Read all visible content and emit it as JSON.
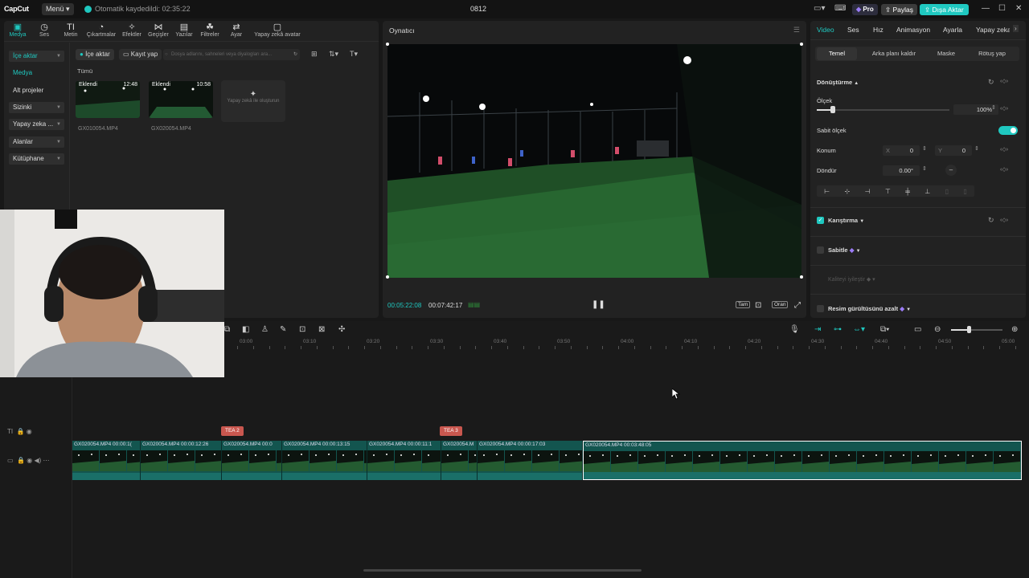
{
  "app": {
    "logo": "CapCut",
    "menu_label": "Menü",
    "saved_status": "Otomatik kaydedildi: 02:35:22",
    "project_title": "0812",
    "pro_label": "Pro",
    "share_label": "Paylaş",
    "export_label": "Dışa Aktar"
  },
  "toolbar": {
    "items": [
      {
        "label": "Medya",
        "icon": "media-icon"
      },
      {
        "label": "Ses",
        "icon": "audio-icon"
      },
      {
        "label": "Metin",
        "icon": "text-icon"
      },
      {
        "label": "Çıkartmalar",
        "icon": "sticker-icon"
      },
      {
        "label": "Efektler",
        "icon": "effects-icon"
      },
      {
        "label": "Geçişler",
        "icon": "transitions-icon"
      },
      {
        "label": "Yazılar",
        "icon": "captions-icon"
      },
      {
        "label": "Filtreler",
        "icon": "filters-icon"
      },
      {
        "label": "Ayar",
        "icon": "adjust-icon"
      },
      {
        "label": "Yapay zekâ avatar",
        "icon": "ai-avatar-icon"
      }
    ]
  },
  "sidebar": {
    "items": [
      {
        "label": "İçe aktar"
      },
      {
        "label": "Medya"
      },
      {
        "label": "Alt projeler"
      },
      {
        "label": "Sizinki"
      },
      {
        "label": "Yapay zeka ..."
      },
      {
        "label": "Alanlar"
      },
      {
        "label": "Kütüphane"
      }
    ]
  },
  "media": {
    "import_btn": "İçe aktar",
    "record_btn": "Kayıt yap",
    "search_placeholder": "Dosya adlarını, sahneleri veya diyalogları ara...",
    "filter_all": "Tümü",
    "items": [
      {
        "tag": "Eklendi",
        "duration": "12:48",
        "name": "GX010054.MP4"
      },
      {
        "tag": "Eklendi",
        "duration": "10:58",
        "name": "GX020054.MP4"
      }
    ],
    "ai_card": "Yapay zekâ ile oluşturun"
  },
  "player": {
    "title": "Oynatıcı",
    "current_time": "00:05:22:08",
    "total_time": "00:07:42:17",
    "full_label": "Tam",
    "ratio_label": "Oran"
  },
  "inspector": {
    "tabs": [
      "Video",
      "Ses",
      "Hız",
      "Animasyon",
      "Ayarla",
      "Yapay zeka"
    ],
    "subtabs": [
      "Temel",
      "Arka planı kaldır",
      "Maske",
      "Rötuş yap"
    ],
    "transform_label": "Dönüştürme",
    "scale_label": "Ölçek",
    "scale_value": "100%",
    "scale_fraction": 0.1,
    "uniform_scale_label": "Sabit ölçek",
    "position_label": "Konum",
    "pos_x_label": "X",
    "pos_x": "0",
    "pos_y_label": "Y",
    "pos_y": "0",
    "rotate_label": "Döndür",
    "rotate_value": "0.00°",
    "blend_label": "Karıştırma",
    "stabilize_label": "Sabitle",
    "enhance_label": "Kaliteyi iyileştir",
    "denoise_label": "Resim gürültüsünü azalt"
  },
  "timeline": {
    "ruler": [
      "03:00",
      "03:10",
      "03:20",
      "03:30",
      "03:40",
      "03:50",
      "04:00",
      "04:10",
      "04:20",
      "04:30",
      "04:40",
      "04:50",
      "05:00"
    ],
    "markers": [
      {
        "label": "TEA 2"
      },
      {
        "label": "TEA 3"
      }
    ],
    "clips": [
      {
        "name": "GX020054.MP4   00:00:1("
      },
      {
        "name": "GX020054.MP4   00:00:12:26"
      },
      {
        "name": "GX020054.MP4   00:0"
      },
      {
        "name": "GX020054.MP4   00:00:13:15"
      },
      {
        "name": "GX020054.MP4   00:00:11:1"
      },
      {
        "name": "GX020054.M"
      },
      {
        "name": "GX020054.MP4   00:00:17:03"
      },
      {
        "name": "GX020054.MP4   00:03:48:05"
      }
    ]
  },
  "colors": {
    "accent": "#1fc8c0",
    "marker": "#c9574f",
    "clip": "#13554f"
  }
}
